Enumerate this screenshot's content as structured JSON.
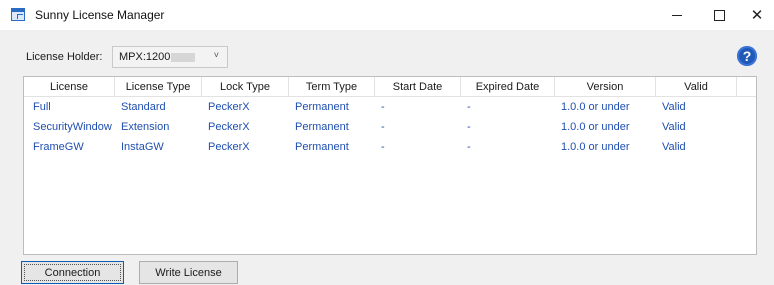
{
  "window": {
    "title": "Sunny License Manager",
    "controls": {
      "minimize": "—",
      "maximize": "□",
      "close": "✕"
    }
  },
  "holder": {
    "label": "License Holder:",
    "value": "MPX:1200",
    "chevron": "˅",
    "help": "?"
  },
  "table": {
    "columns": [
      "License",
      "License Type",
      "Lock Type",
      "Term Type",
      "Start Date",
      "Expired Date",
      "Version",
      "Valid"
    ],
    "rows": [
      [
        "Full",
        "Standard",
        "PeckerX",
        "Permanent",
        "-",
        "-",
        "1.0.0 or under",
        "Valid"
      ],
      [
        "SecurityWindow",
        "Extension",
        "PeckerX",
        "Permanent",
        "-",
        "-",
        "1.0.0 or under",
        "Valid"
      ],
      [
        "FrameGW",
        "InstaGW",
        "PeckerX",
        "Permanent",
        "-",
        "-",
        "1.0.0 or under",
        "Valid"
      ]
    ]
  },
  "buttons": {
    "connection": "Connection",
    "write_license": "Write License"
  },
  "colors": {
    "cell_text": "#1f4fb0",
    "help_icon": "#2159b9",
    "window_bg": "#f0f0f0"
  },
  "icons": {
    "app": "license-manager-icon",
    "help": "help-icon"
  }
}
